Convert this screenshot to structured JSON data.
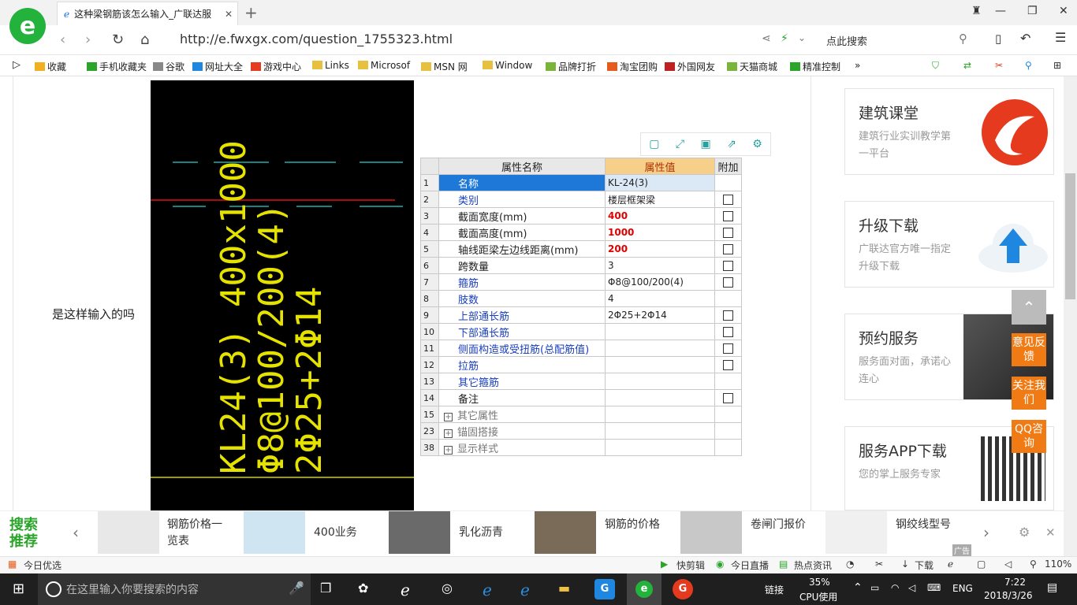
{
  "browser": {
    "tab_title": "这种梁钢筋该怎么输入_广联达服",
    "new_tab": "+",
    "url": "http://e.fwxgx.com/question_1755323.html",
    "search_placeholder": "点此搜索",
    "logo": "e"
  },
  "bookmarks": [
    "收藏",
    "手机收藏夹",
    "谷歌",
    "网址大全",
    "游戏中心",
    "Links",
    "Microsof",
    "MSN 网",
    "Window",
    "品牌打折",
    "淘宝团购",
    "外国网友",
    "天猫商城",
    "精准控制"
  ],
  "page": {
    "question": "是这样输入的吗",
    "cad_lines": [
      "KL24(3) 400x1000",
      "Φ8@100/200(4)",
      "2Φ25+2Φ14"
    ]
  },
  "table": {
    "headers": [
      "属性名称",
      "属性值",
      "附加"
    ],
    "rows": [
      {
        "n": "1",
        "name": "名称",
        "value": "KL-24(3)",
        "blue": true,
        "chk": false,
        "selected": true
      },
      {
        "n": "2",
        "name": "类别",
        "value": "楼层框架梁",
        "blue": true,
        "chk": true
      },
      {
        "n": "3",
        "name": "截面宽度(mm)",
        "value": "400",
        "blue": false,
        "chk": true,
        "red": true
      },
      {
        "n": "4",
        "name": "截面高度(mm)",
        "value": "1000",
        "blue": false,
        "chk": true,
        "red": true
      },
      {
        "n": "5",
        "name": "轴线距梁左边线距离(mm)",
        "value": "200",
        "blue": false,
        "chk": true,
        "red": true
      },
      {
        "n": "6",
        "name": "跨数量",
        "value": "3",
        "blue": false,
        "chk": true
      },
      {
        "n": "7",
        "name": "箍筋",
        "value": "Φ8@100/200(4)",
        "blue": true,
        "chk": true
      },
      {
        "n": "8",
        "name": "肢数",
        "value": "4",
        "blue": true,
        "chk": false
      },
      {
        "n": "9",
        "name": "上部通长筋",
        "value": "2Φ25+2Φ14",
        "blue": true,
        "chk": true
      },
      {
        "n": "10",
        "name": "下部通长筋",
        "value": "",
        "blue": true,
        "chk": true
      },
      {
        "n": "11",
        "name": "侧面构造或受扭筋(总配筋值)",
        "value": "",
        "blue": true,
        "chk": true
      },
      {
        "n": "12",
        "name": "拉筋",
        "value": "",
        "blue": true,
        "chk": true
      },
      {
        "n": "13",
        "name": "其它箍筋",
        "value": "",
        "blue": true,
        "chk": false
      },
      {
        "n": "14",
        "name": "备注",
        "value": "",
        "blue": false,
        "chk": true
      },
      {
        "n": "15",
        "name": "其它属性",
        "value": "",
        "gray": true,
        "plus": true
      },
      {
        "n": "23",
        "name": "锚固搭接",
        "value": "",
        "gray": true,
        "plus": true
      },
      {
        "n": "38",
        "name": "显示样式",
        "value": "",
        "gray": true,
        "plus": true
      }
    ]
  },
  "sidebar": {
    "cards": [
      {
        "title": "建筑课堂",
        "sub": "建筑行业实训教学第一平台"
      },
      {
        "title": "升级下载",
        "sub": "广联达官方唯一指定升级下载"
      },
      {
        "title": "预约服务",
        "sub": "服务面对面，承诺心连心"
      },
      {
        "title": "服务APP下载",
        "sub": "您的掌上服务专家"
      }
    ],
    "float_buttons": [
      "意见反馈",
      "关注我们",
      "QQ咨询"
    ]
  },
  "promo": {
    "title": "搜索推荐",
    "items": [
      "钢筋价格一览表",
      "400业务",
      "乳化沥青",
      "钢筋的价格",
      "卷闸门报价",
      "钢绞线型号"
    ],
    "ad": "广告"
  },
  "statusbar": {
    "left": "今日优选",
    "items": [
      "快剪辑",
      "今日直播",
      "热点资讯",
      "下载"
    ],
    "zoom": "110%"
  },
  "taskbar": {
    "search_placeholder": "在这里输入你要搜索的内容",
    "links": "链接",
    "cpu": "35%",
    "cpu_label": "CPU使用",
    "lang": "ENG",
    "time": "7:22",
    "date": "2018/3/26"
  }
}
